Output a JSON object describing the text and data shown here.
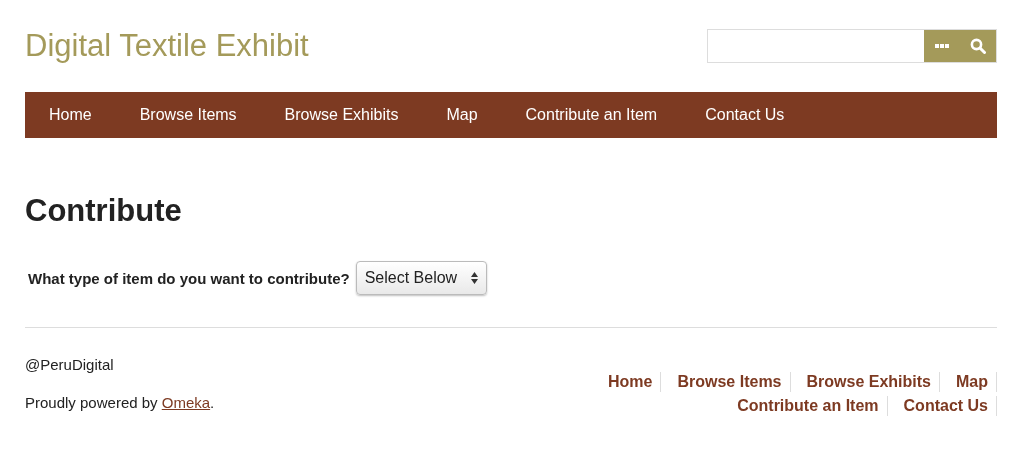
{
  "site_title": "Digital Textile Exhibit",
  "nav": [
    {
      "label": "Home"
    },
    {
      "label": "Browse Items"
    },
    {
      "label": "Browse Exhibits"
    },
    {
      "label": "Map"
    },
    {
      "label": "Contribute an Item"
    },
    {
      "label": "Contact Us"
    }
  ],
  "page_title": "Contribute",
  "form": {
    "label": "What type of item do you want to contribute?",
    "select_value": "Select Below"
  },
  "footer": {
    "handle": "@PeruDigital",
    "powered_by": {
      "text": "Proudly powered by ",
      "link": "Omeka",
      "suffix": "."
    },
    "links": [
      {
        "label": "Home"
      },
      {
        "label": "Browse Items"
      },
      {
        "label": "Browse Exhibits"
      },
      {
        "label": "Map"
      },
      {
        "label": "Contribute an Item"
      },
      {
        "label": "Contact Us"
      }
    ]
  }
}
